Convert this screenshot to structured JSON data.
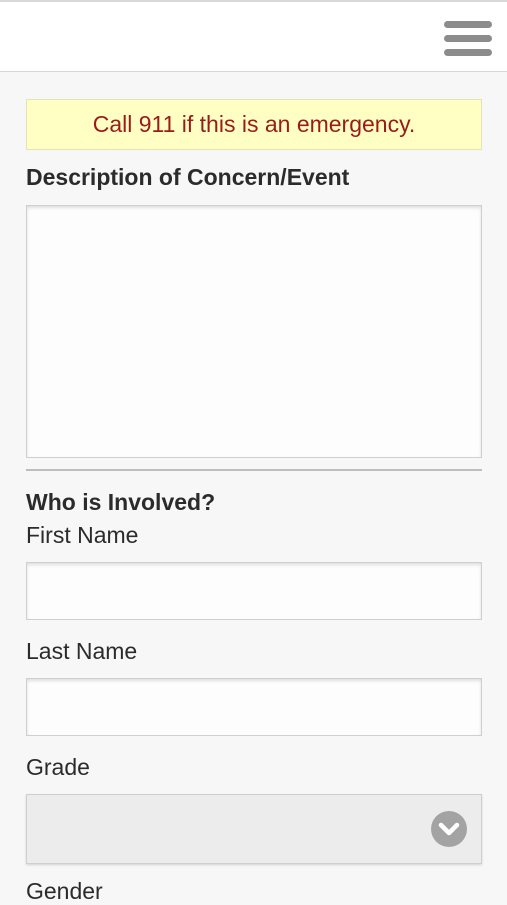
{
  "header": {
    "menu_icon": "hamburger-menu-icon"
  },
  "banner": {
    "text": "Call 911 if this is an emergency."
  },
  "description": {
    "label": "Description of Concern/Event",
    "value": ""
  },
  "involved": {
    "heading": "Who is Involved?",
    "first_name_label": "First Name",
    "first_name_value": "",
    "last_name_label": "Last Name",
    "last_name_value": "",
    "grade_label": "Grade",
    "grade_selected": "",
    "gender_label": "Gender"
  },
  "colors": {
    "banner_bg": "#ffffc4",
    "banner_text": "#9b1b1b",
    "menu_icon": "#8c8c8c"
  }
}
